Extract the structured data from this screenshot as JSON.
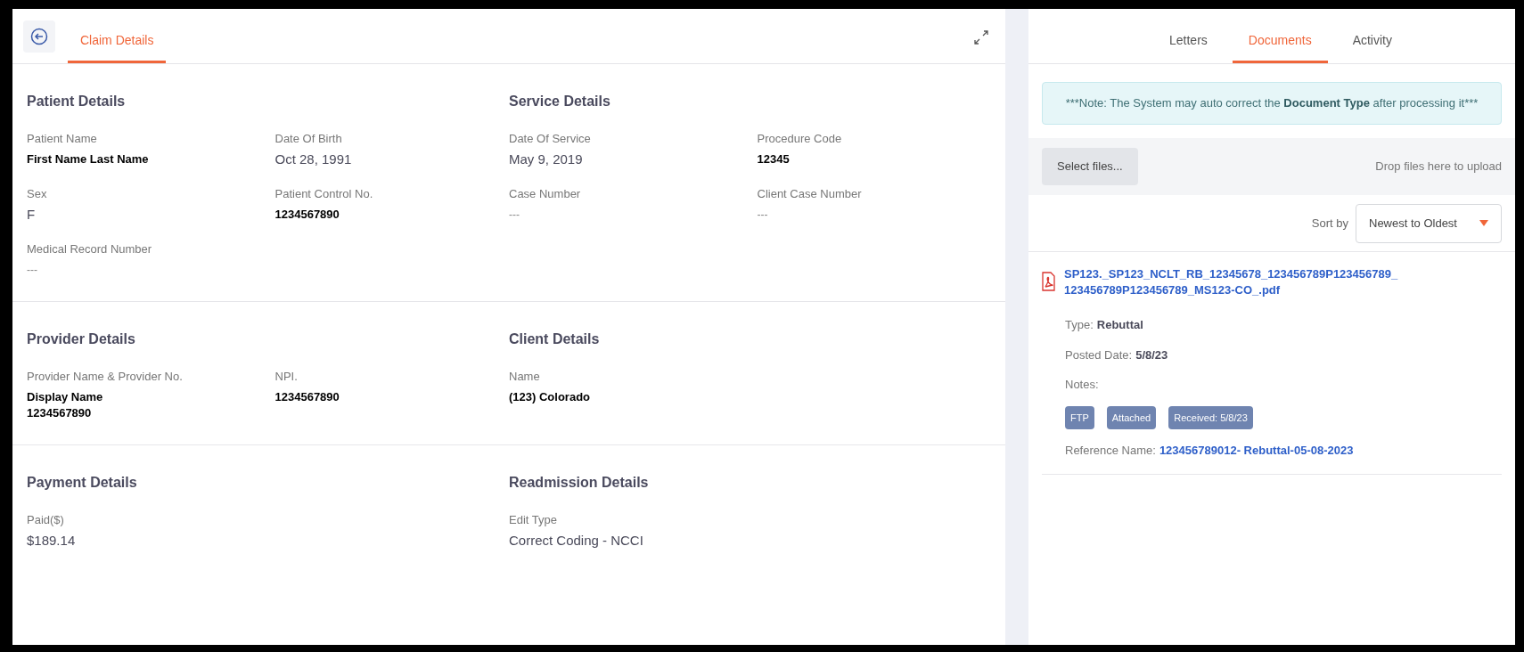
{
  "claim_tabs": [
    {
      "label": "Claim Details",
      "selected": true
    }
  ],
  "section_rows": [
    [
      {
        "title": "Patient Details",
        "fields": [
          {
            "label": "Patient Name",
            "value": [
              "First Name Last Name"
            ],
            "kind": "strong"
          },
          {
            "label": "Date Of Birth",
            "value": [
              "Oct 28, 1991"
            ],
            "kind": "plain"
          },
          {
            "label": "Sex",
            "value": [
              "F"
            ],
            "kind": "plain"
          },
          {
            "label": "Patient Control No.",
            "value": [
              "1234567890"
            ],
            "kind": "strong"
          },
          {
            "label": "Medical Record Number",
            "value": [
              "---"
            ],
            "kind": "empty"
          }
        ]
      },
      {
        "title": "Service Details",
        "fields": [
          {
            "label": "Date Of Service",
            "value": [
              "May 9, 2019"
            ],
            "kind": "plain"
          },
          {
            "label": "Procedure Code",
            "value": [
              "12345"
            ],
            "kind": "strong"
          },
          {
            "label": "Case Number",
            "value": [
              "---"
            ],
            "kind": "empty"
          },
          {
            "label": "Client Case Number",
            "value": [
              "---"
            ],
            "kind": "empty"
          }
        ]
      }
    ],
    [
      {
        "title": "Provider Details",
        "fields": [
          {
            "label": "Provider Name & Provider No.",
            "value": [
              "Display Name",
              "1234567890"
            ],
            "kind": "strong"
          },
          {
            "label": "NPI.",
            "value": [
              "1234567890"
            ],
            "kind": "strong"
          }
        ]
      },
      {
        "title": "Client Details",
        "fields": [
          {
            "label": "Name",
            "value": [
              "(123) Colorado"
            ],
            "kind": "strong"
          }
        ]
      }
    ],
    [
      {
        "title": "Payment Details",
        "fields": [
          {
            "label": "Paid($)",
            "value": [
              "$189.14"
            ],
            "kind": "plain"
          }
        ]
      },
      {
        "title": "Readmission Details",
        "fields": [
          {
            "label": "Edit Type",
            "value": [
              "Correct Coding - NCCI"
            ],
            "kind": "plain"
          }
        ]
      }
    ]
  ],
  "panel_tabs": [
    {
      "label": "Letters",
      "selected": false
    },
    {
      "label": "Documents",
      "selected": true
    },
    {
      "label": "Activity",
      "selected": false
    }
  ],
  "note": [
    {
      "text": "***Note: The System may auto correct the ",
      "bold": false
    },
    {
      "text": "Document Type",
      "bold": true
    },
    {
      "text": " after processing it***",
      "bold": false
    }
  ],
  "upload": {
    "button": "Select files...",
    "hint": "Drop files here to upload"
  },
  "sort": {
    "label": "Sort by",
    "value": "Newest to Oldest"
  },
  "documents": [
    {
      "file_name": [
        "SP123._SP123_NCLT_RB_12345678_123456789P123456789_",
        "123456789P123456789_MS123-CO_.pdf"
      ],
      "type_label": "Type:",
      "type": "Rebuttal",
      "posted_label": "Posted Date:",
      "posted": "5/8/23",
      "notes_label": "Notes:",
      "tags": [
        "FTP",
        "Attached",
        "Received: 5/8/23"
      ],
      "reference_label": "Reference Name:",
      "reference": "123456789012- Rebuttal-05-08-2023"
    }
  ]
}
